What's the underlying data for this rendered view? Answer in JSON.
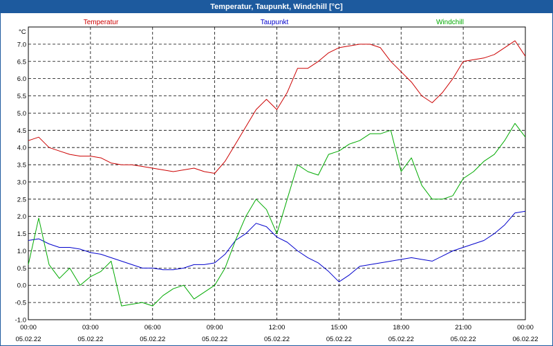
{
  "window": {
    "title": "Temperatur, Taupunkt, Windchill [°C]"
  },
  "colors": {
    "titlebar": "#1d5a9e",
    "temperature": "#cc0000",
    "dewpoint": "#0000cc",
    "windchill": "#00aa00"
  },
  "chart_data": {
    "type": "line",
    "title": "Temperatur, Taupunkt, Windchill [°C]",
    "ylabel": "°C",
    "ylim": [
      -1.0,
      7.5
    ],
    "xlim": [
      0,
      24
    ],
    "grid": true,
    "legend_position": "top",
    "yticks": [
      "-1.0",
      "-0.5",
      "0.0",
      "0.5",
      "1.0",
      "1.5",
      "2.0",
      "2.5",
      "3.0",
      "3.5",
      "4.0",
      "4.5",
      "5.0",
      "5.5",
      "6.0",
      "6.5",
      "7.0"
    ],
    "xticks": [
      {
        "time": "00:00",
        "date": "05.02.22"
      },
      {
        "time": "03:00",
        "date": "05.02.22"
      },
      {
        "time": "06:00",
        "date": "05.02.22"
      },
      {
        "time": "09:00",
        "date": "05.02.22"
      },
      {
        "time": "12:00",
        "date": "05.02.22"
      },
      {
        "time": "15:00",
        "date": "05.02.22"
      },
      {
        "time": "18:00",
        "date": "05.02.22"
      },
      {
        "time": "21:00",
        "date": "05.02.22"
      },
      {
        "time": "00:00",
        "date": "06.02.22"
      }
    ],
    "series": [
      {
        "name": "Temperatur",
        "color": "#cc0000",
        "x": [
          0,
          0.5,
          1,
          1.5,
          2,
          2.5,
          3,
          3.5,
          4,
          4.5,
          5,
          5.5,
          6,
          6.5,
          7,
          7.5,
          8,
          8.5,
          9,
          9.5,
          10,
          10.5,
          11,
          11.5,
          12,
          12.5,
          13,
          13.5,
          14,
          14.5,
          15,
          15.5,
          16,
          16.5,
          17,
          17.5,
          18,
          18.5,
          19,
          19.5,
          20,
          20.5,
          21,
          21.5,
          22,
          22.5,
          23,
          23.5,
          24
        ],
        "values": [
          4.2,
          4.3,
          4.0,
          3.9,
          3.8,
          3.75,
          3.75,
          3.7,
          3.55,
          3.5,
          3.5,
          3.45,
          3.4,
          3.35,
          3.3,
          3.35,
          3.4,
          3.3,
          3.25,
          3.6,
          4.1,
          4.6,
          5.1,
          5.4,
          5.1,
          5.6,
          6.3,
          6.3,
          6.5,
          6.75,
          6.9,
          6.95,
          7.0,
          7.0,
          6.9,
          6.5,
          6.2,
          5.9,
          5.5,
          5.3,
          5.6,
          6.0,
          6.5,
          6.55,
          6.6,
          6.7,
          6.9,
          7.1,
          6.65
        ]
      },
      {
        "name": "Taupunkt",
        "color": "#0000cc",
        "x": [
          0,
          0.5,
          1,
          1.5,
          2,
          2.5,
          3,
          3.5,
          4,
          4.5,
          5,
          5.5,
          6,
          6.5,
          7,
          7.5,
          8,
          8.5,
          9,
          9.5,
          10,
          10.5,
          11,
          11.5,
          12,
          12.5,
          13,
          13.5,
          14,
          14.5,
          15,
          15.5,
          16,
          16.5,
          17,
          17.5,
          18,
          18.5,
          19,
          19.5,
          20,
          20.5,
          21,
          21.5,
          22,
          22.5,
          23,
          23.5,
          24
        ],
        "values": [
          1.3,
          1.35,
          1.2,
          1.1,
          1.1,
          1.05,
          0.95,
          0.9,
          0.8,
          0.7,
          0.6,
          0.5,
          0.5,
          0.45,
          0.45,
          0.5,
          0.6,
          0.6,
          0.65,
          0.9,
          1.3,
          1.5,
          1.8,
          1.7,
          1.4,
          1.25,
          1.0,
          0.8,
          0.65,
          0.4,
          0.1,
          0.3,
          0.55,
          0.6,
          0.65,
          0.7,
          0.75,
          0.8,
          0.75,
          0.7,
          0.85,
          1.0,
          1.1,
          1.2,
          1.3,
          1.5,
          1.75,
          2.1,
          2.15
        ]
      },
      {
        "name": "Windchill",
        "color": "#00aa00",
        "x": [
          0,
          0.5,
          1,
          1.5,
          2,
          2.5,
          3,
          3.5,
          4,
          4.5,
          5,
          5.5,
          6,
          6.5,
          7,
          7.5,
          8,
          8.5,
          9,
          9.5,
          10,
          10.5,
          11,
          11.5,
          12,
          12.5,
          13,
          13.5,
          14,
          14.5,
          15,
          15.5,
          16,
          16.5,
          17,
          17.5,
          18,
          18.5,
          19,
          19.5,
          20,
          20.5,
          21,
          21.5,
          22,
          22.5,
          23,
          23.5,
          24
        ],
        "values": [
          0.6,
          1.95,
          0.6,
          0.2,
          0.5,
          0.0,
          0.25,
          0.4,
          0.7,
          -0.6,
          -0.55,
          -0.5,
          -0.6,
          -0.3,
          -0.1,
          0.0,
          -0.4,
          -0.2,
          0.0,
          0.5,
          1.3,
          2.0,
          2.5,
          2.2,
          1.5,
          2.5,
          3.5,
          3.3,
          3.2,
          3.8,
          3.9,
          4.1,
          4.2,
          4.4,
          4.4,
          4.5,
          3.3,
          3.7,
          2.9,
          2.5,
          2.5,
          2.6,
          3.1,
          3.3,
          3.6,
          3.8,
          4.2,
          4.7,
          4.3
        ]
      }
    ]
  }
}
